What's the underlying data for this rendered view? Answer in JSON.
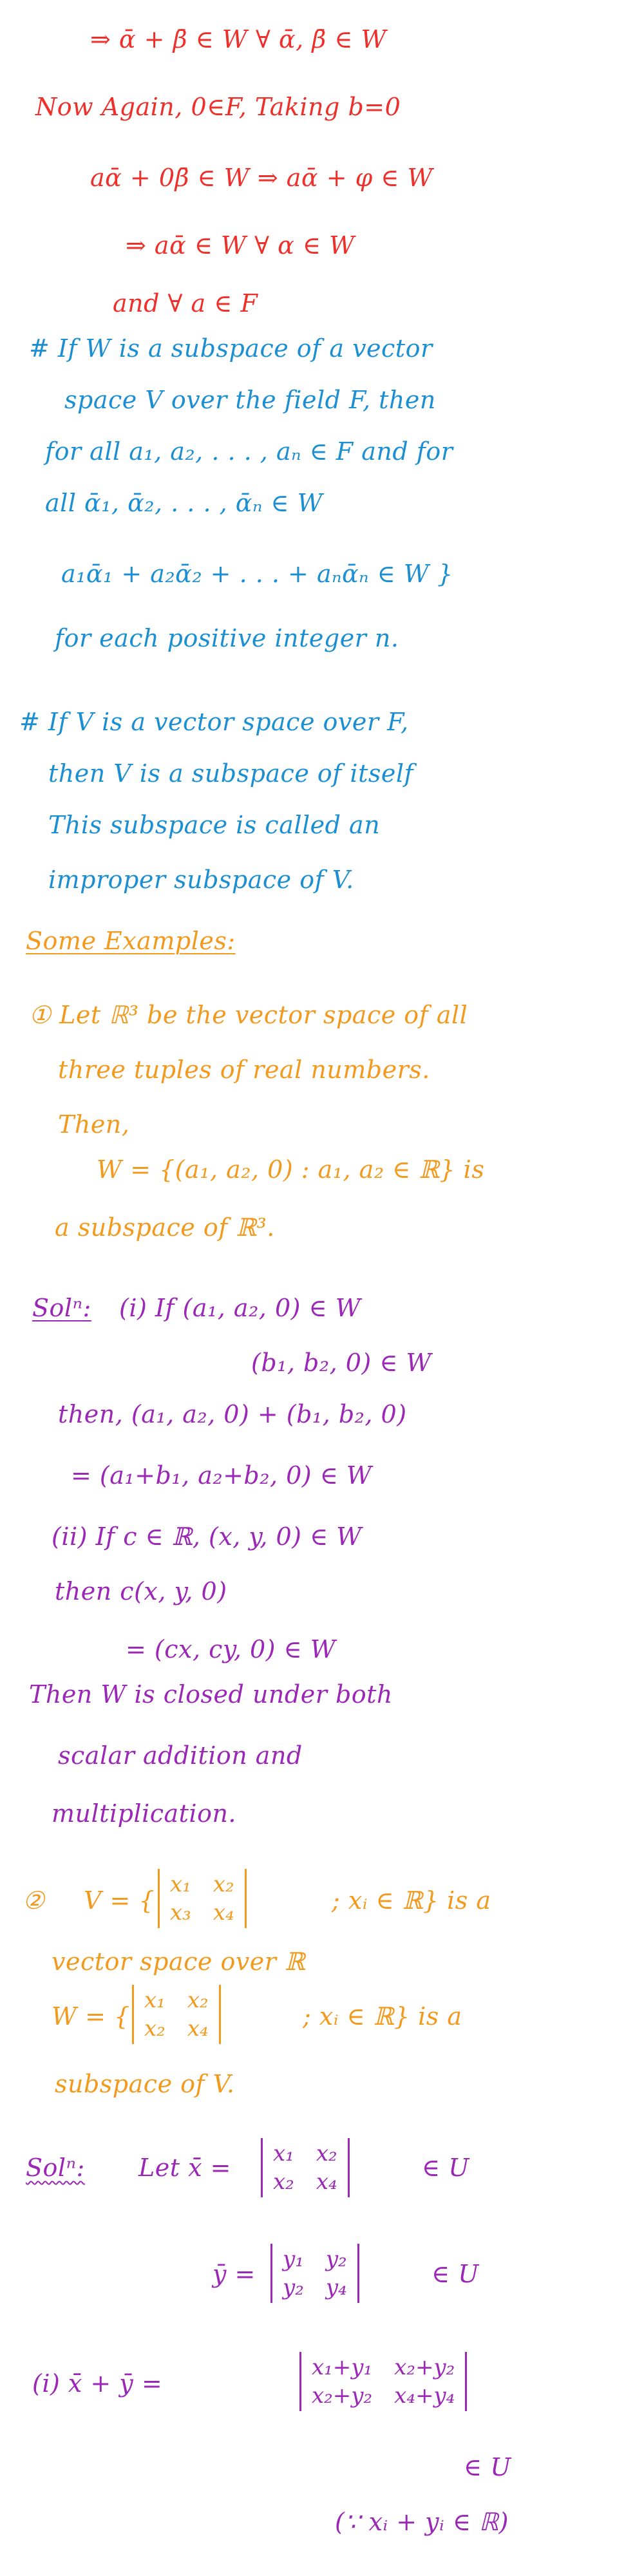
{
  "colors": {
    "red": "#ee2f2a",
    "blue": "#1c8fd3",
    "orange": "#f29a1e",
    "purple": "#9b27b6"
  },
  "lines": [
    "⇒ ᾱ + β̄ ∈ W   ∀ ᾱ, β̄ ∈ W",
    "Now Again, 0∈F, Taking b=0",
    "aᾱ + 0β̄ ∈ W ⇒ aᾱ + φ ∈ W",
    "⇒ aᾱ ∈ W  ∀ α ∈ W",
    "and ∀ a ∈ F",
    "# If W is a subspace of a vector",
    "space V over the field F, then",
    "for all a₁, a₂, . . . , aₙ ∈ F and for",
    "all ᾱ₁, ᾱ₂, . . . , ᾱₙ ∈ W",
    "a₁ᾱ₁ + a₂ᾱ₂ + . . . + aₙᾱₙ ∈ W }",
    "for each positive integer n.",
    "# If V is a vector space over F,",
    "then V is a subspace of itself",
    "This subspace is called an",
    "improper subspace of V.",
    "Some Examples:",
    "① Let ℝ³ be the vector space of all",
    "three tuples of real numbers.",
    "Then,",
    "W = {(a₁, a₂, 0) : a₁, a₂ ∈ ℝ} is",
    "a subspace of ℝ³.",
    "Solⁿ:",
    "(i) If (a₁, a₂, 0) ∈ W",
    "(b₁, b₂, 0) ∈ W",
    "then,   (a₁, a₂, 0) + (b₁, b₂, 0)",
    "= (a₁+b₁, a₂+b₂, 0) ∈ W",
    "(ii) If c ∈ ℝ,  (x, y, 0) ∈ W",
    "then    c(x, y, 0)",
    "= (cx, cy, 0) ∈ W",
    "Then W is closed under both",
    "scalar addition and",
    "multiplication.",
    "②",
    "V = {",
    "; xᵢ ∈ ℝ} is a",
    "vector space over ℝ",
    "W = {",
    "; xᵢ ∈ ℝ} is a",
    "subspace of V.",
    "Solⁿ:",
    "Let  x̄ =",
    "∈ U",
    "ȳ =",
    "∈ U",
    "(i)  x̄ + ȳ  =",
    "∈ U",
    "(∵ xᵢ + yᵢ ∈ ℝ)"
  ],
  "matrices": {
    "V": [
      "x₁",
      "x₂",
      "x₃",
      "x₄"
    ],
    "W": [
      "x₁",
      "x₂",
      "x₂",
      "x₄"
    ],
    "x": [
      "x₁",
      "x₂",
      "x₂",
      "x₄"
    ],
    "y": [
      "y₁",
      "y₂",
      "y₂",
      "y₄"
    ],
    "sum": [
      "x₁+y₁",
      "x₂+y₂",
      "x₂+y₂",
      "x₄+y₄"
    ]
  }
}
